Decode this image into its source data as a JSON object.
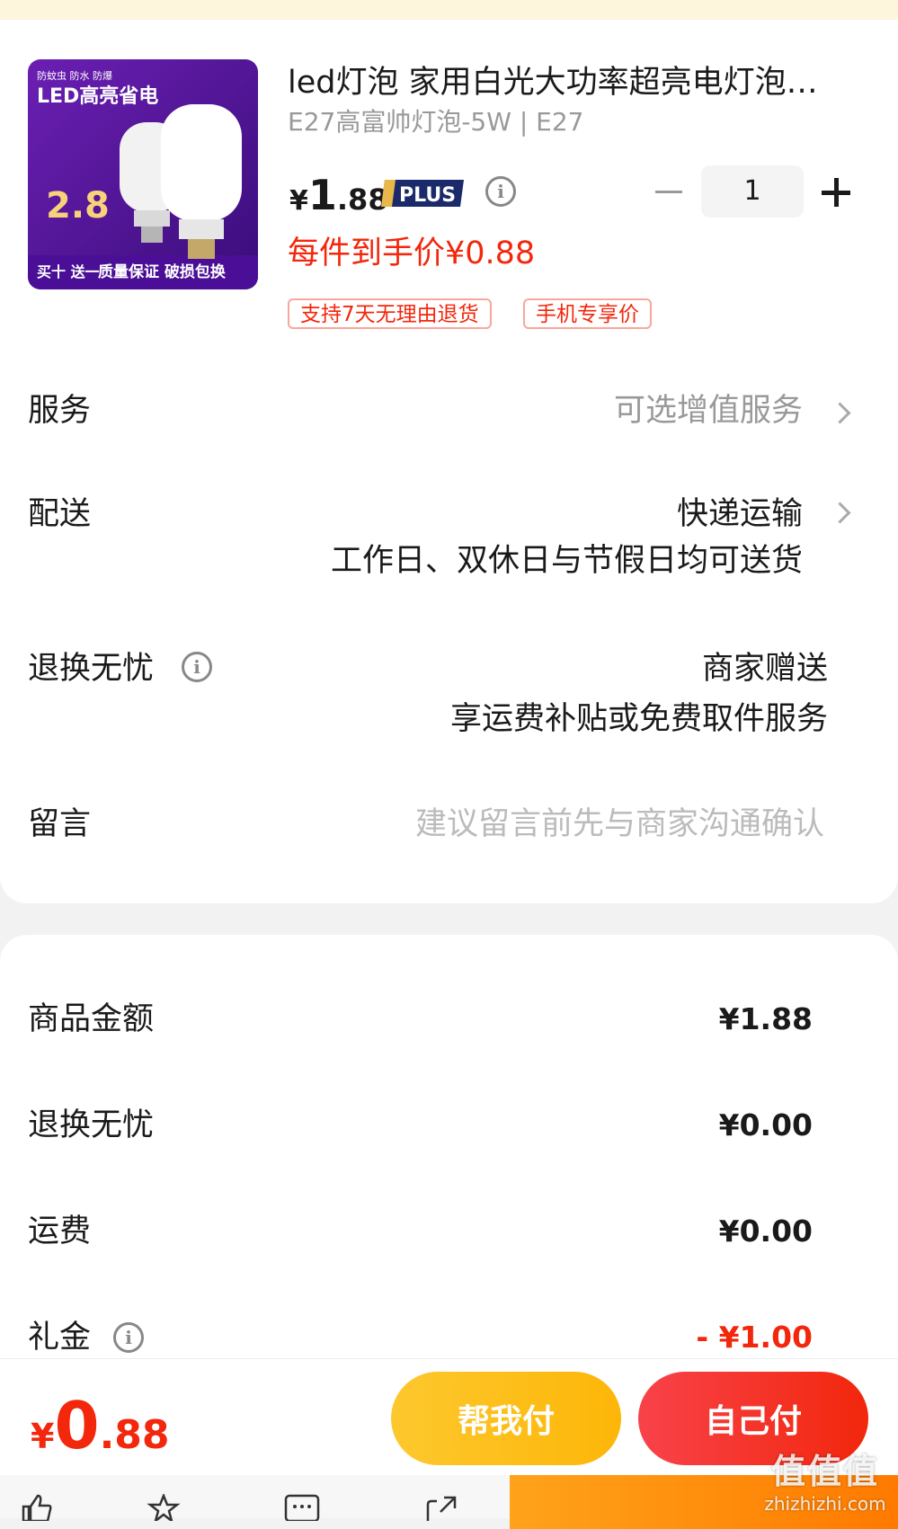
{
  "product": {
    "title": "led灯泡 家用白光大功率超亮电灯泡…",
    "spec": "E27高富帅灯泡-5W | E27",
    "price_currency": "¥",
    "price_int": "1",
    "price_dec": ".88",
    "plus_badge": "PLUS",
    "quantity": "1",
    "hand_price": "每件到手价¥0.88",
    "tags": [
      "支持7天无理由退货",
      "手机专享价"
    ],
    "image": {
      "top_small": "防蚊虫 防水 防爆",
      "headline": "LED高亮省电",
      "price": "2.8",
      "promo_left": "买十 送一",
      "promo_right": "质量保证 破损包换"
    }
  },
  "service": {
    "label": "服务",
    "value": "可选增值服务"
  },
  "delivery": {
    "label": "配送",
    "value": "快递运输",
    "note": "工作日、双休日与节假日均可送货"
  },
  "return": {
    "label": "退换无忧",
    "value": "商家赠送",
    "note": "享运费补贴或免费取件服务"
  },
  "message": {
    "label": "留言",
    "placeholder": "建议留言前先与商家沟通确认"
  },
  "amounts": [
    {
      "label": "商品金额",
      "value": "¥1.88"
    },
    {
      "label": "退换无忧",
      "value": "¥0.00"
    },
    {
      "label": "运费",
      "value": "¥0.00"
    },
    {
      "label": "礼金",
      "value": "- ¥1.00"
    }
  ],
  "footer": {
    "total_currency": "¥",
    "total_int": "0",
    "total_dec": ".88",
    "help_pay": "帮我付",
    "self_pay": "自己付"
  },
  "watermark": {
    "title": "值值值",
    "url": "zhizhizhi.com"
  },
  "colors": {
    "price_red": "#f2270c",
    "help_yellow": "#fdc82e",
    "self_red": "#f2270c",
    "plus_navy": "#1b2a6b"
  }
}
